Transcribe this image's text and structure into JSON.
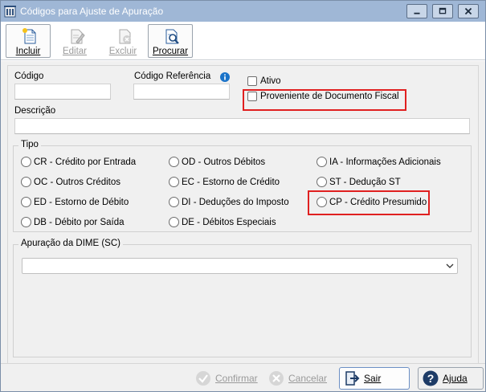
{
  "window": {
    "title": "Códigos para Ajuste de Apuração",
    "controls": {
      "minimize": "minimize-icon",
      "maximize": "maximize-icon",
      "close": "close-icon"
    }
  },
  "toolbar": {
    "incluir": "Incluir",
    "editar": "Editar",
    "excluir": "Excluir",
    "procurar": "Procurar"
  },
  "form": {
    "codigo_label": "Código",
    "codigo_value": "",
    "codigo_ref_label": "Código Referência",
    "ativo_label": "Ativo",
    "proveniente_label": "Proveniente de Documento Fiscal",
    "descricao_label": "Descrição",
    "descricao_value": "",
    "tipo_label": "Tipo",
    "tipo_options": [
      "CR - Crédito por Entrada",
      "OC - Outros Créditos",
      "ED - Estorno de Débito",
      "DB - Débito por Saída",
      "OD - Outros Débitos",
      "EC - Estorno de Crédito",
      "DI - Deduções do Imposto",
      "DE - Débitos Especiais",
      "IA - Informações Adicionais",
      "ST - Dedução ST",
      "CP - Crédito Presumido"
    ],
    "dime_label": "Apuração da DIME (SC)",
    "dime_value": ""
  },
  "buttons": {
    "confirmar": "Confirmar",
    "cancelar": "Cancelar",
    "sair": "Sair",
    "ajuda": "Ajuda"
  },
  "colors": {
    "titlebar": "#9fb7d6",
    "highlight": "#e02020",
    "info_icon": "#1a73c9"
  }
}
